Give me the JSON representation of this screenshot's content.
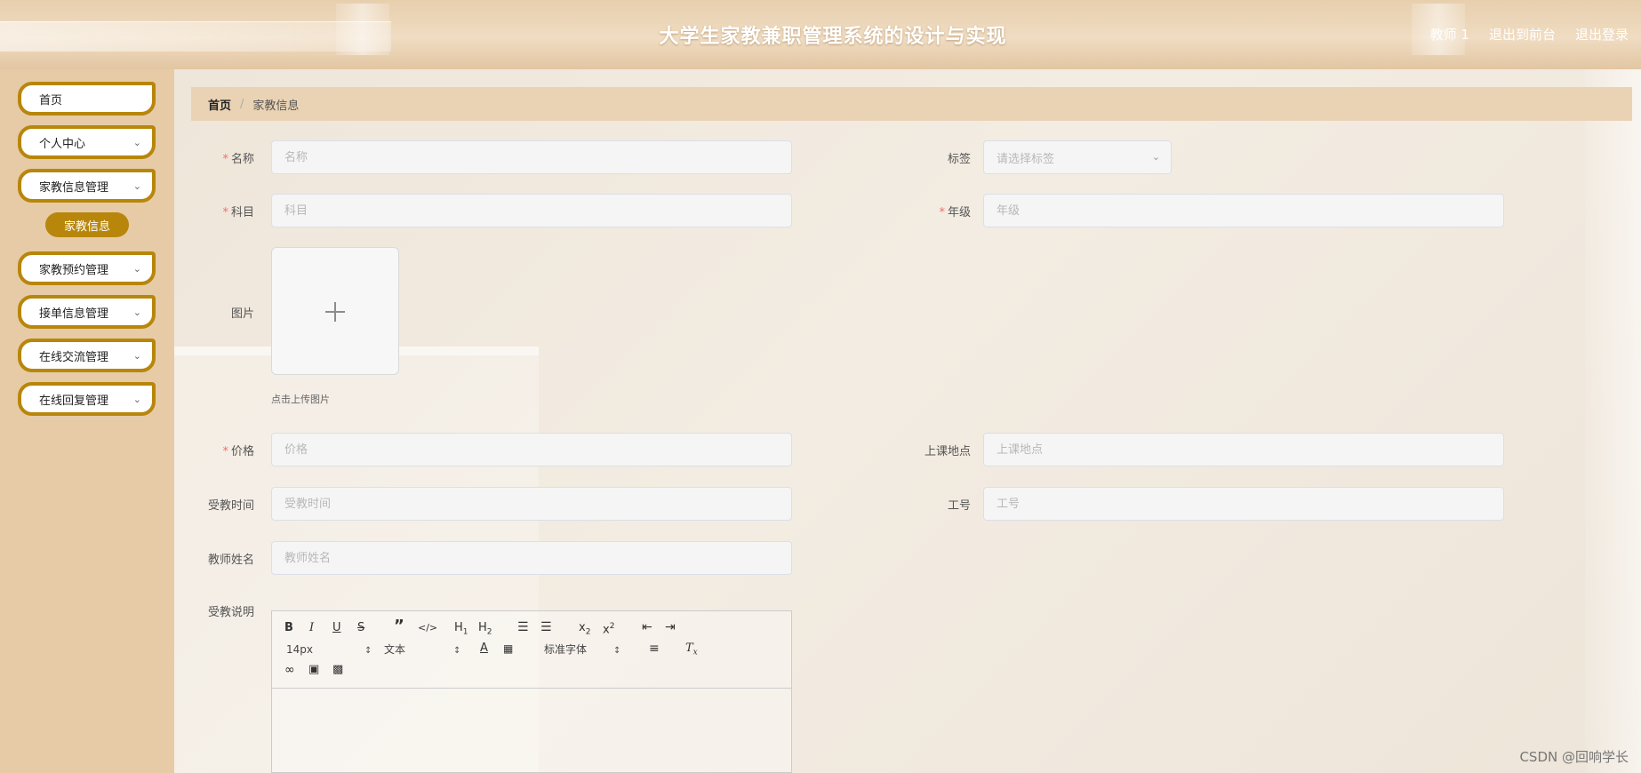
{
  "header": {
    "title": "大学生家教兼职管理系统的设计与实现",
    "user": "教师 1",
    "links": [
      "退出到前台",
      "退出登录"
    ]
  },
  "sidebar": {
    "items": [
      {
        "label": "首页"
      },
      {
        "label": "个人中心"
      },
      {
        "label": "家教信息管理"
      },
      {
        "label": "家教预约管理"
      },
      {
        "label": "接单信息管理"
      },
      {
        "label": "在线交流管理"
      },
      {
        "label": "在线回复管理"
      }
    ],
    "active_sub": "家教信息"
  },
  "breadcrumb": {
    "home": "首页",
    "sep": "/",
    "current": "家教信息"
  },
  "form": {
    "name": {
      "label": "名称",
      "placeholder": "名称",
      "value": ""
    },
    "tag": {
      "label": "标签",
      "placeholder": "请选择标签"
    },
    "subject": {
      "label": "科目",
      "placeholder": "科目",
      "value": ""
    },
    "grade": {
      "label": "年级",
      "placeholder": "年级",
      "value": ""
    },
    "image": {
      "label": "图片",
      "tip": "点击上传图片"
    },
    "price": {
      "label": "价格",
      "placeholder": "价格",
      "value": ""
    },
    "location": {
      "label": "上课地点",
      "placeholder": "上课地点",
      "value": ""
    },
    "time": {
      "label": "受教时间",
      "placeholder": "受教时间",
      "value": ""
    },
    "staff_no": {
      "label": "工号",
      "placeholder": "工号",
      "value": ""
    },
    "teacher": {
      "label": "教师姓名",
      "placeholder": "教师姓名",
      "value": ""
    },
    "desc": {
      "label": "受教说明"
    },
    "required_mark": "*"
  },
  "editor": {
    "font_size": "14px",
    "text_type": "文本",
    "font_family": "标准字体"
  },
  "watermark": "CSDN @回响学长",
  "colors": {
    "accent": "#b8860b",
    "sidebar": "#e6cba6",
    "breadcrumb": "#ead3b4"
  }
}
